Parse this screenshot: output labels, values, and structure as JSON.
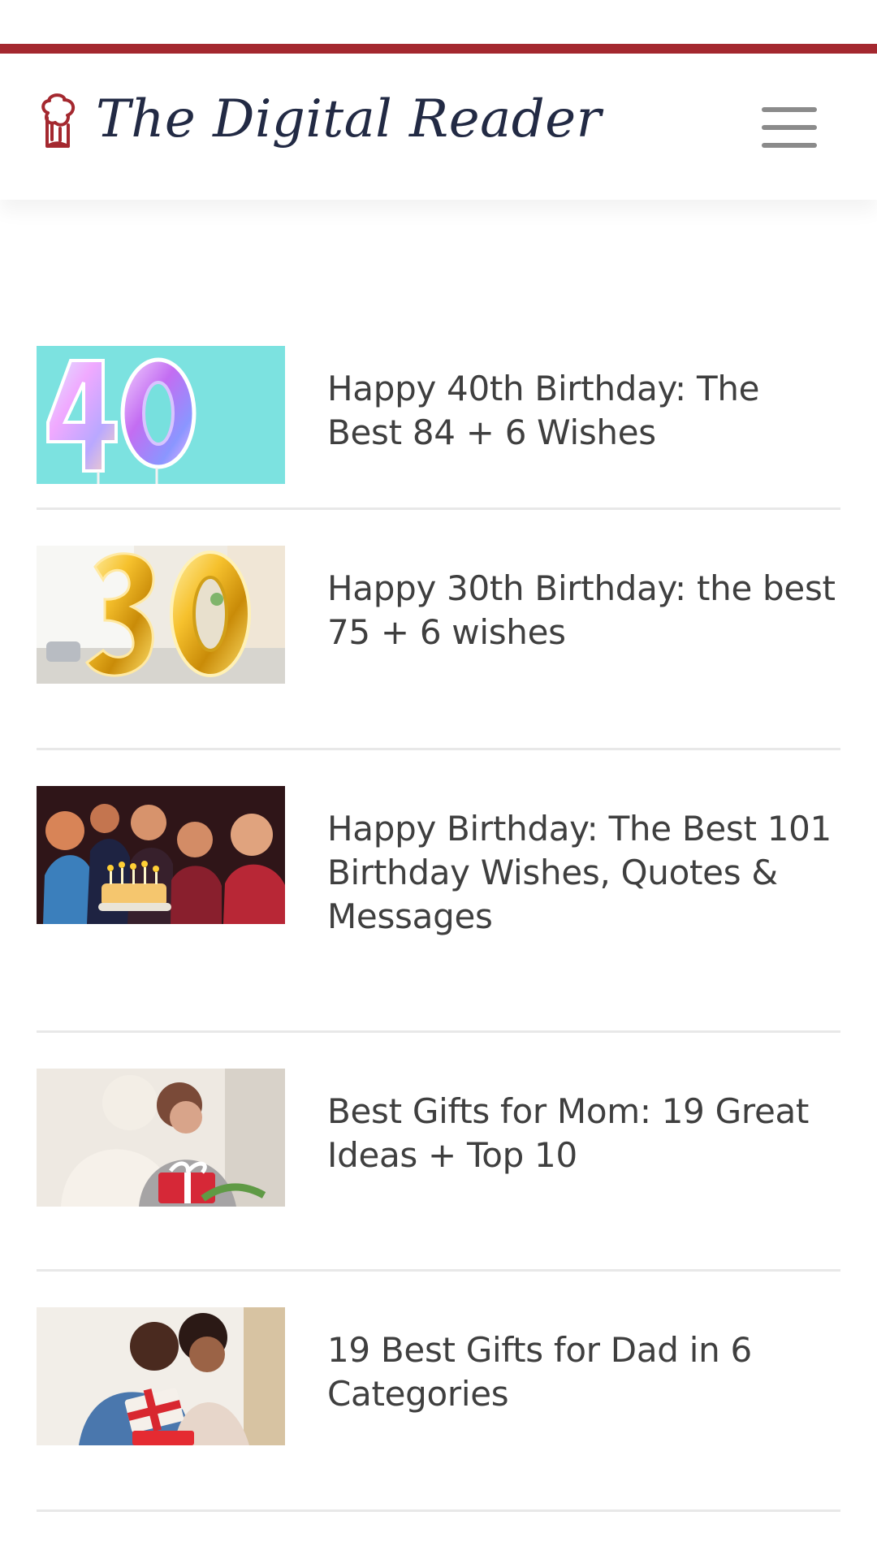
{
  "site": {
    "title": "The Digital Reader"
  },
  "articles": [
    {
      "title": "Happy 40th Birthday: The Best 84 + 6 Wishes",
      "image": "40-balloons-image"
    },
    {
      "title": "Happy 30th Birthday: the best 75 + 6 wishes",
      "image": "30-balloons-image"
    },
    {
      "title": "Happy Birthday: The Best 101 Birthday Wishes, Quotes & Messages",
      "image": "birthday-party-image"
    },
    {
      "title": "Best Gifts for Mom: 19 Great Ideas + Top 10",
      "image": "mother-daughter-gift-image"
    },
    {
      "title": "19 Best Gifts for Dad in 6 Categories",
      "image": "father-child-gift-image"
    }
  ],
  "colors": {
    "accent": "#a4282f",
    "title_text": "#3f3f3f",
    "logo_text": "#222a44",
    "menu_icon": "#8b8b8b"
  },
  "icons": {
    "logo": "book-stack-icon",
    "menu": "hamburger-menu-icon"
  }
}
